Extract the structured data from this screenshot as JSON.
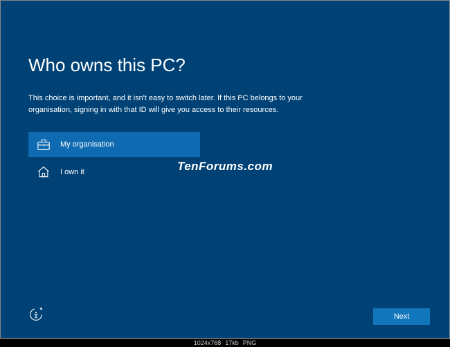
{
  "title": "Who owns this PC?",
  "description": "This choice is important, and it isn't easy to switch later. If this PC belongs to your organisation, signing in with that ID will give you access to their resources.",
  "options": [
    {
      "label": "My organisation",
      "selected": true,
      "icon": "briefcase-icon"
    },
    {
      "label": "I own it",
      "selected": false,
      "icon": "home-icon"
    }
  ],
  "watermark": "TenForums.com",
  "next_button": "Next",
  "status": {
    "dimensions": "1024x768",
    "filesize": "17kb",
    "format": "PNG"
  }
}
